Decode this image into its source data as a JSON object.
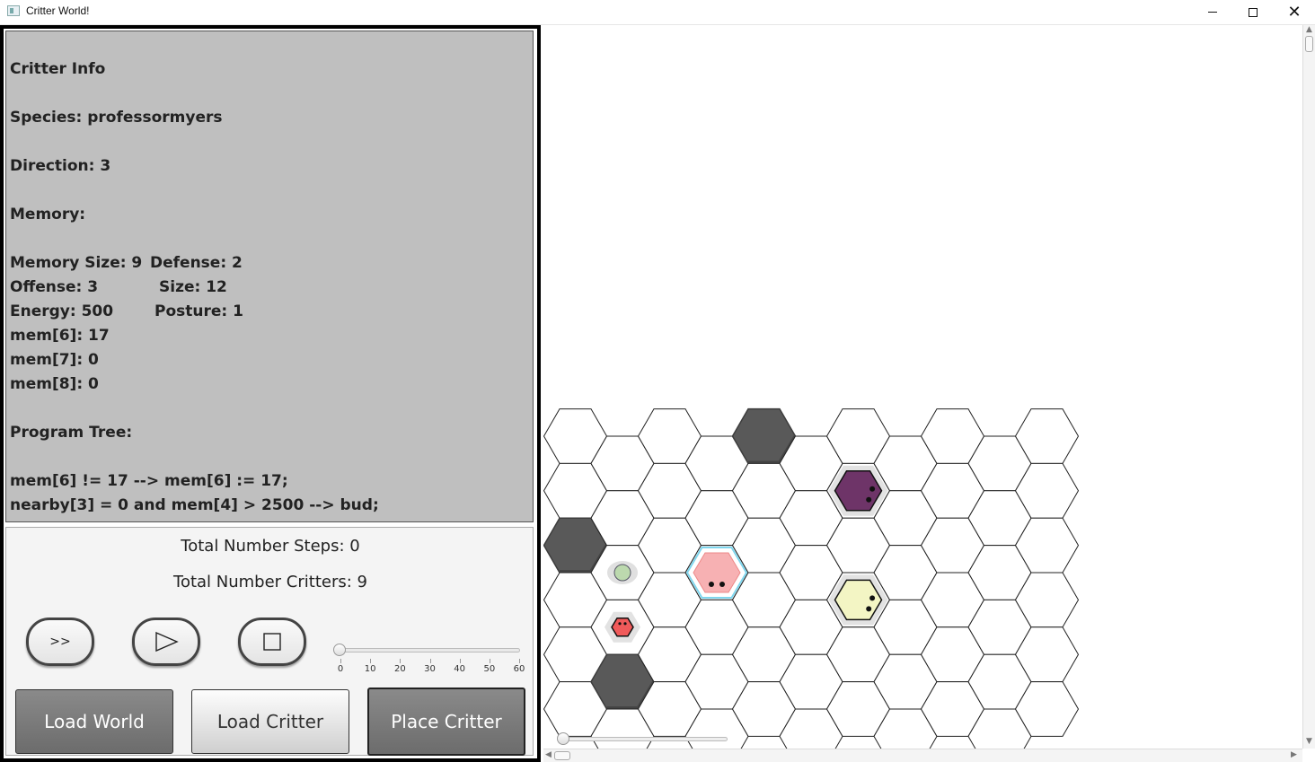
{
  "window": {
    "title": "Critter World!"
  },
  "info": {
    "heading": "Critter Info",
    "species": "Species: professormyers",
    "direction": "Direction: 3",
    "memory_label": "Memory:",
    "mem_size": "Memory Size: 9",
    "defense": "Defense: 2",
    "offense": "Offense: 3",
    "size": "Size: 12",
    "energy": "Energy: 500",
    "posture": "Posture: 1",
    "mem6": "mem[6]: 17",
    "mem7": "mem[7]: 0",
    "mem8": "mem[8]: 0",
    "program_label": "Program Tree:",
    "rule1": "mem[6] != 17 --> mem[6] := 17;",
    "rule2": "nearby[3] = 0 and mem[4] > 2500 --> bud;"
  },
  "stats": {
    "steps": "Total Number Steps: 0",
    "critters": "Total Number Critters: 9"
  },
  "controls": {
    "fast_forward": ">>",
    "speed_slider": {
      "value": 0,
      "min": 0,
      "max": 60,
      "ticks": [
        "0",
        "10",
        "20",
        "30",
        "40",
        "50",
        "60"
      ]
    }
  },
  "buttons": {
    "load_world": "Load World",
    "load_critter": "Load Critter",
    "place_critter": "Place Critter"
  },
  "world": {
    "rows": 6,
    "cols": 11,
    "cell_colors": {
      "rock": "#595959",
      "selected_outline": "#7fd6ee"
    },
    "rocks": [
      [
        0,
        2
      ],
      [
        1,
        4
      ],
      [
        4,
        0
      ]
    ],
    "critters": [
      {
        "col": 6,
        "row": 1,
        "kind": "critter",
        "color": "#6e3468"
      },
      {
        "col": 3,
        "row": 2,
        "kind": "critter",
        "color": "#f7b1b3",
        "selected": true
      },
      {
        "col": 6,
        "row": 3,
        "kind": "critter",
        "color": "#f3f5c4"
      },
      {
        "col": 1,
        "row": 2,
        "kind": "food",
        "color": "#bcd9ae"
      },
      {
        "col": 1,
        "row": 3,
        "kind": "critter",
        "color": "#f05a5a"
      }
    ]
  }
}
